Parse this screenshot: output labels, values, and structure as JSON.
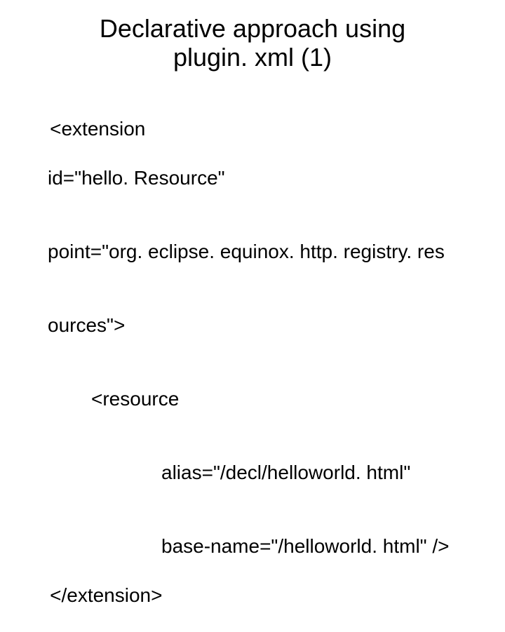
{
  "title_line1": "Declarative approach using",
  "title_line2": "plugin. xml (1)",
  "code": {
    "l1": "<extension",
    "l2": "id=\"hello. Resource\"",
    "l3": "point=\"org. eclipse. equinox. http. registry. res",
    "l4": "ources\">",
    "l5": "<resource",
    "l6": "alias=\"/decl/helloworld. html\"",
    "l7": "base-name=\"/helloworld. html\" />",
    "l8": "</extension>"
  }
}
